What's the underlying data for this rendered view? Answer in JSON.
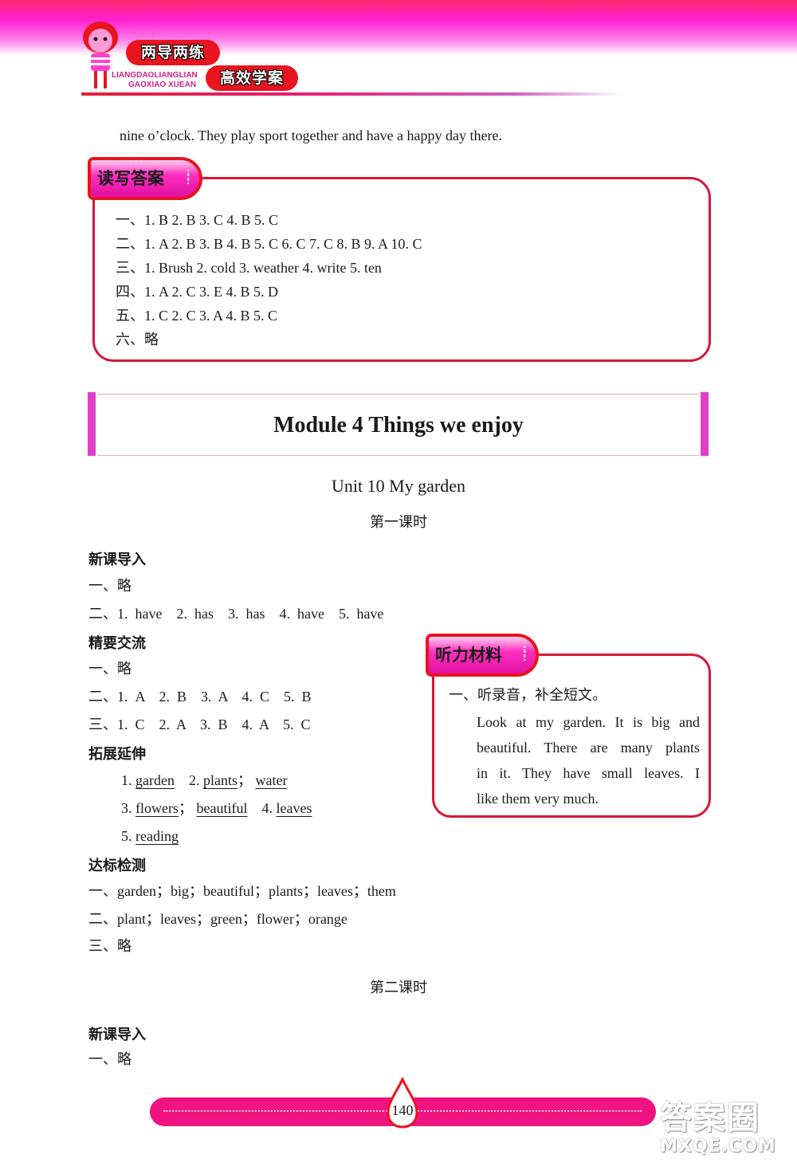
{
  "header": {
    "brand_cn": "两导两练",
    "brand_pinyin_1": "LIANGDAOLIANGLIAN",
    "brand_pinyin_2": "GAOXIAO XUEAN",
    "series_cn": "高效学案"
  },
  "intro_line": "nine o’clock.  They play sport together and have a happy day there.",
  "reading_writing": {
    "label": "读写答案",
    "lines": [
      "一、1. B  2. B  3. C  4. B  5. C",
      "二、1. A  2. B  3. B  4. B  5. C  6. C  7. C  8. B  9. A  10. C",
      "三、1. Brush  2. cold  3. weather  4. write  5. ten",
      "四、1. A  2. C  3. E  4. B  5. D",
      "五、1. C  2. C  3. A  4. B  5. C",
      "六、略"
    ]
  },
  "module": {
    "title": "Module 4 Things we enjoy",
    "unit": "Unit 10 My garden",
    "lesson_1": "第一课时",
    "lesson_2": "第二课时"
  },
  "lesson1": {
    "xinke": {
      "heading": "新课导入",
      "lines": [
        "一、略",
        "二、1.  have    2.  has    3.  has    4.  have    5.  have"
      ]
    },
    "jingyao": {
      "heading": "精要交流",
      "lines": [
        "一、略",
        "二、1.  A    2.  B    3.  A    4.  C    5.  B",
        "三、1.  C    2.  A    3.  B    4.  A    5.  C"
      ]
    },
    "tuozhan": {
      "heading": "拓展延伸",
      "items": [
        {
          "num": "1.",
          "words": [
            "garden"
          ]
        },
        {
          "num": "2.",
          "words": [
            "plants",
            "water"
          ]
        },
        {
          "num": "3.",
          "words": [
            "flowers",
            "beautiful"
          ]
        },
        {
          "num": "4.",
          "words": [
            "leaves"
          ]
        },
        {
          "num": "5.",
          "words": [
            "reading"
          ]
        }
      ]
    },
    "dabiao": {
      "heading": "达标检测",
      "lines": [
        "一、garden；big；beautiful；plants；leaves；them",
        "二、plant；leaves；green；flower；orange",
        "三、略"
      ]
    }
  },
  "listening": {
    "label": "听力材料",
    "instruction": "一、听录音，补全短文。",
    "passage_lines": [
      "Look at my garden. It is big and",
      "beautiful. There are many plants",
      "in it. They have small leaves. I",
      "like them very much."
    ]
  },
  "lesson2": {
    "heading": "新课导入",
    "lines": [
      "一、略"
    ]
  },
  "footer": {
    "page_number": "140"
  },
  "watermark": {
    "line1": "答案圈",
    "line2": "MXQE.COM"
  },
  "colors": {
    "accent_red": "#e8141e",
    "accent_magenta": "#f01480",
    "box_border": "#d31a3a"
  }
}
